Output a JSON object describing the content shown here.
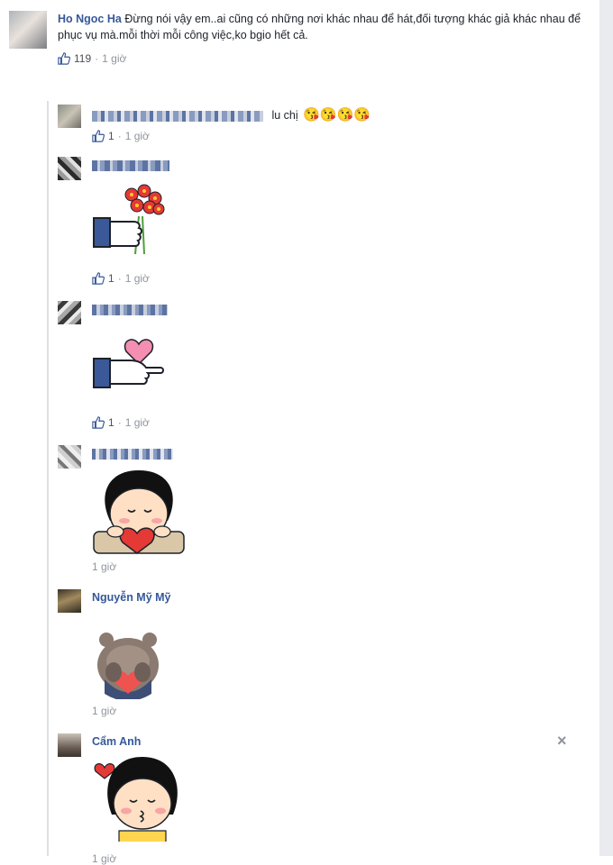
{
  "main_comment": {
    "author": "Ho Ngoc Ha",
    "text": "Đừng nói vậy em..ai cũng có những nơi khác nhau để hát,đối tượng khác giả khác nhau để phục vụ mà.mỗi thời mỗi công việc,ko bgio hết cả.",
    "likes": "119",
    "separator": "·",
    "time": "1 giờ"
  },
  "replies": [
    {
      "text": "lu chị",
      "emoji": [
        "😘",
        "😘",
        "😘",
        "😘"
      ],
      "likes": "1",
      "separator": "·",
      "time": "1 giờ"
    },
    {
      "sticker": "like-hand-flowers-sticker",
      "likes": "1",
      "separator": "·",
      "time": "1 giờ"
    },
    {
      "sticker": "like-hand-heart-sticker",
      "likes": "1",
      "separator": "·",
      "time": "1 giờ"
    },
    {
      "sticker": "girl-holding-heart-sticker",
      "time": "1 giờ"
    },
    {
      "author": "Nguyễn Mỹ Mỹ",
      "sticker": "bear-holding-heart-sticker",
      "time": "1 giờ"
    },
    {
      "author": "Cẩm Anh",
      "sticker": "girl-kissing-sticker",
      "time": "1 giờ",
      "close": "×"
    }
  ],
  "colors": {
    "link": "#365899",
    "meta": "#90949c",
    "thread_line": "#dddfe2"
  }
}
